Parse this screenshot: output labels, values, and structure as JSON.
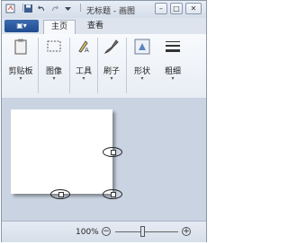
{
  "titlebar": {
    "title": "无标题 - 画图",
    "minimize": "–",
    "maximize": "□",
    "close": "✕"
  },
  "tabs": {
    "app_menu": "▣▾",
    "home": "主页",
    "view": "查看"
  },
  "ribbon": {
    "groups": [
      {
        "label": "剪贴板",
        "arrow": "▾"
      },
      {
        "label": "图像",
        "arrow": "▾"
      },
      {
        "label": "工具",
        "arrow": "▾"
      },
      {
        "label": "刷子",
        "arrow": "▾"
      },
      {
        "label": "形状",
        "arrow": "▾"
      },
      {
        "label": "粗细",
        "arrow": "▾"
      }
    ]
  },
  "status": {
    "zoom": "100%",
    "zoom_out": "−",
    "zoom_in": "+",
    "zoom_level": 100
  },
  "colors": {
    "workspace": "#c9d3e1",
    "ribbon": "#eef2f7",
    "app_menu": "#2b5aa0"
  }
}
